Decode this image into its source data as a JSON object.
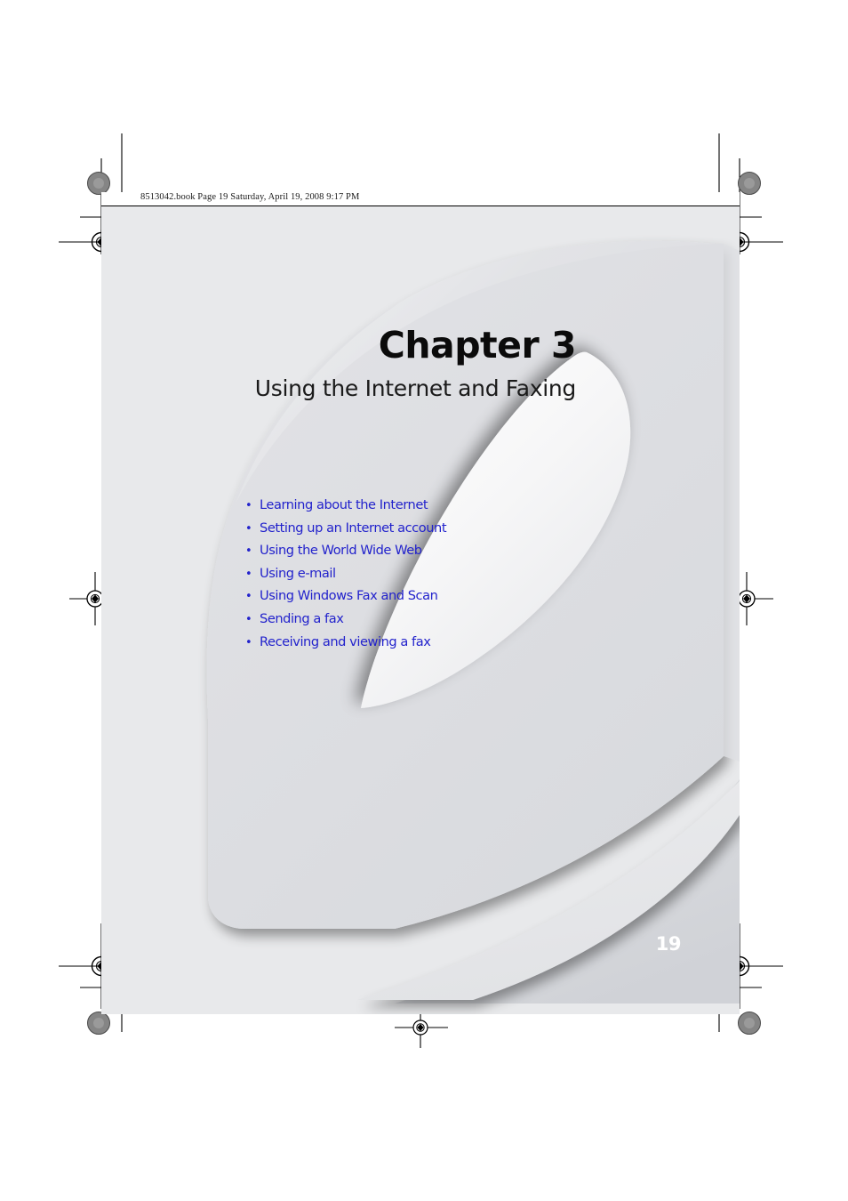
{
  "document": {
    "running_head": "8513042.book  Page 19  Saturday, April 19, 2008  9:17 PM",
    "page_number": "19"
  },
  "heading": {
    "chapter_label": "Chapter 3",
    "subtitle": "Using the Internet and Faxing"
  },
  "topics": {
    "bullet_glyph": "•",
    "items": [
      {
        "label": "Learning about the Internet"
      },
      {
        "label": "Setting up an Internet account"
      },
      {
        "label": "Using the World Wide Web"
      },
      {
        "label": "Using e-mail"
      },
      {
        "label": "Using Windows Fax and Scan"
      },
      {
        "label": "Sending a fax"
      },
      {
        "label": "Receiving and viewing a fax"
      }
    ]
  },
  "artwork": {
    "background_logo": "lowercase-e-logo",
    "registration_mark": "registration-target-icon",
    "color_patch": "color-patch-icon"
  },
  "colors": {
    "page_background": "#e8e9eb",
    "outer_background": "#ffffff",
    "topic_link": "#2222cc",
    "chapter_title": "#0b0b0b",
    "folio": "#ffffff",
    "logo_light": "#f1f2f3",
    "logo_mid": "#e0e1e4",
    "logo_dark": "#d6d8dc"
  }
}
